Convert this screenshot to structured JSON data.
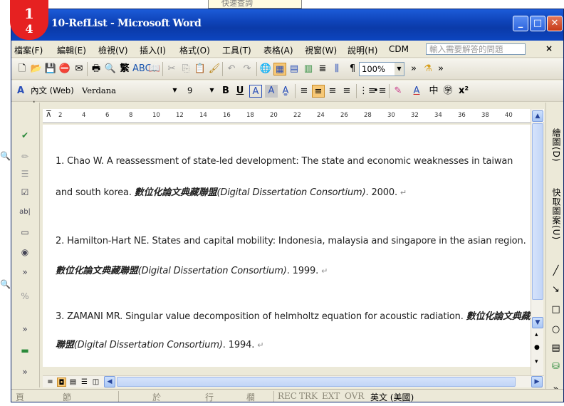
{
  "window": {
    "title": "10-RefList - Microsoft Word",
    "badge_line1": "1",
    "badge_line2": "4",
    "background_tab": "快速查詢"
  },
  "menubar": {
    "items": [
      "檔案(F)",
      "編輯(E)",
      "檢視(V)",
      "插入(I)",
      "格式(O)",
      "工具(T)",
      "表格(A)",
      "視窗(W)",
      "說明(H)",
      "CDM"
    ],
    "help_placeholder": "輸入需要解答的問題",
    "close_label": "×"
  },
  "toolbar_standard": {
    "zoom": "100%",
    "convert_label": "繁"
  },
  "toolbar_formatting": {
    "style": "內文 (Web) +",
    "font": "Verdana",
    "size": "9",
    "bold": "B",
    "underline": "U",
    "char_border": "A",
    "char_shading": "A"
  },
  "ruler": {
    "ticks": [
      "2",
      "4",
      "6",
      "8",
      "10",
      "12",
      "14",
      "16",
      "18",
      "20",
      "22",
      "24",
      "26",
      "28",
      "30",
      "32",
      "34",
      "36",
      "38",
      "40"
    ]
  },
  "document": {
    "ref1_line1": "1. Chao W. A reassessment of state-led development: The state and economic weaknesses in taiwan",
    "ref1_line2a": "and south korea. ",
    "ref1_line2b": "數位化論文典藏聯盟",
    "ref1_line2c": "(Digital Dissertation Consortium)",
    "ref1_line2d": ". 2000. ",
    "ref2_line1": "2. Hamilton-Hart NE. States and capital mobility: Indonesia, malaysia and singapore in the asian region.",
    "ref2_line2a": "數位化論文典藏聯盟",
    "ref2_line2b": "(Digital Dissertation Consortium)",
    "ref2_line2c": ". 1999. ",
    "ref3_line1a": "3. ZAMANI MR. Singular value decomposition of helmholtz equation for acoustic radiation. ",
    "ref3_line1b": "數位化論文典藏",
    "ref3_line2a": "聯盟",
    "ref3_line2b": "(Digital Dissertation Consortium)",
    "ref3_line2c": ". 1994. ",
    "para_mark": "↵"
  },
  "right_panel": {
    "draw_label": "繪圖(D)",
    "autoshape_label": "快取圖案(U)"
  },
  "status_bar": {
    "page": "頁",
    "section": "節",
    "at": "於",
    "line": "行",
    "column": "欄",
    "rec": "REC",
    "trk": "TRK",
    "ext": "EXT",
    "ovr": "OVR",
    "language": "英文 (美國)"
  }
}
